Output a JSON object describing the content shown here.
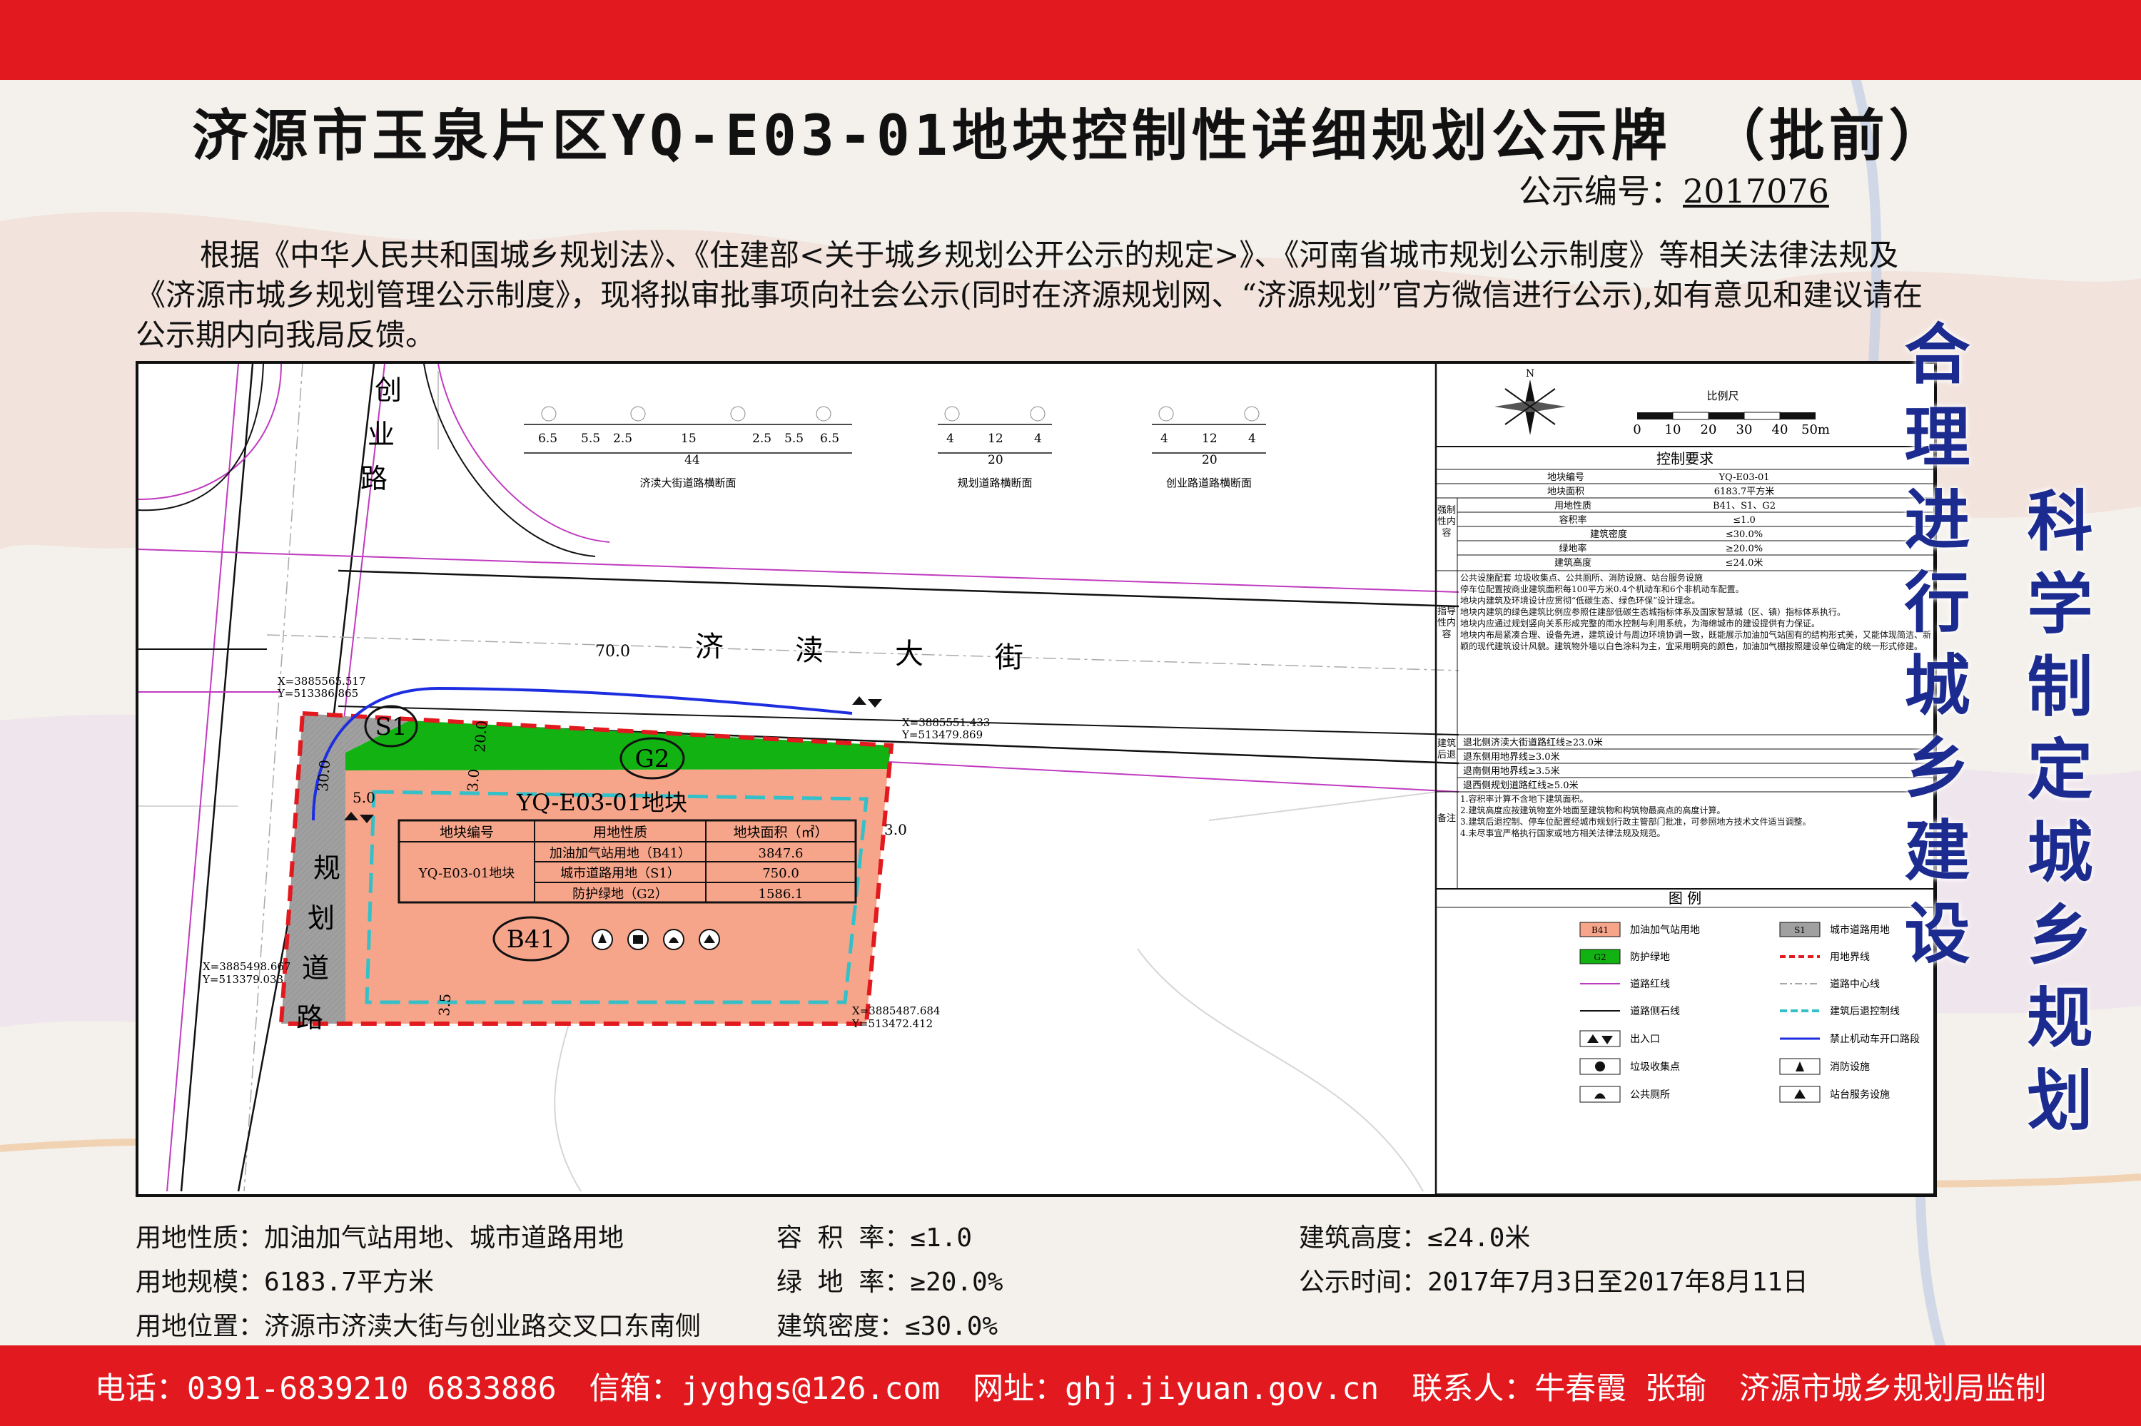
{
  "title": "济源市玉泉片区YQ-E03-01地块控制性详细规划公示牌 （批前）",
  "notice_label": "公示编号：",
  "notice_no": "2017076",
  "intro": "根据《中华人民共和国城乡规划法》、《住建部<关于城乡规划公开公示的规定>》、《河南省城市规划公示制度》等相关法律法规及《济源市城乡规划管理公示制度》，现将拟审批事项向社会公示(同时在济源规划网、“济源规划”官方微信进行公示),如有意见和建议请在公示期内向我局反馈。",
  "slogans": {
    "left": "合理进行城乡建设",
    "right": "科学制定城乡规划"
  },
  "map": {
    "roads": {
      "chuangye": "创业路",
      "jidu": "济渎大街",
      "guihua": "规划道路"
    },
    "road_width_jidu": "70.0",
    "dims": {
      "d30_left": "30.0",
      "d20": "20.0",
      "d3_top": "3.0",
      "d5": "5.0",
      "d3_right": "3.0",
      "d3_bottom": "3.5"
    },
    "parcel_labels": {
      "s1": "S1",
      "g2": "G2",
      "b41": "B41",
      "block": "YQ-E03-01地块"
    },
    "coords": [
      {
        "x": "X=3885565.517",
        "y": "Y=513386.865"
      },
      {
        "x": "X=3885551.433",
        "y": "Y=513479.869"
      },
      {
        "x": "X=3885498.667",
        "y": "Y=513379.033"
      },
      {
        "x": "X=3885487.684",
        "y": "Y=513472.412"
      }
    ],
    "parcel_table": {
      "headers": [
        "地块编号",
        "用地性质",
        "地块面积（㎡）"
      ],
      "block_id": "YQ-E03-01地块",
      "rows": [
        [
          "加油加气站用地（B41）",
          "3847.6"
        ],
        [
          "城市道路用地（S1）",
          "750.0"
        ],
        [
          "防护绿地（G2）",
          "1586.1"
        ]
      ]
    },
    "sections": [
      {
        "dims": [
          "6.5",
          "5.5",
          "2.5",
          "15",
          "2.5",
          "5.5",
          "6.5"
        ],
        "total": "44",
        "caption": "济渎大街道路横断面"
      },
      {
        "dims": [
          "4",
          "12",
          "4"
        ],
        "total": "20",
        "caption": "规划道路横断面"
      },
      {
        "dims": [
          "4",
          "12",
          "4"
        ],
        "total": "20",
        "caption": "创业路道路横断面"
      }
    ],
    "north": "N",
    "scale": {
      "label": "比例尺",
      "ticks": [
        "0",
        "10",
        "20",
        "30",
        "40",
        "50m"
      ]
    },
    "control": {
      "title": "控制要求",
      "rows": [
        [
          "地块编号",
          "YQ-E03-01"
        ],
        [
          "地块面积",
          "6183.7平方米"
        ]
      ],
      "mandatory_label": "强制性内容",
      "mandatory": [
        [
          "用地性质",
          "B41、S1、G2"
        ],
        [
          "容积率",
          "≤1.0"
        ],
        [
          "建筑密度",
          "≤30.0%"
        ],
        [
          "绿地率",
          "≥20.0%"
        ],
        [
          "建筑高度",
          "≤24.0米"
        ]
      ],
      "guide_label": "指导性内容",
      "guide": [
        "公共设施配套 垃圾收集点、公共厕所、消防设施、站台服务设施",
        "停车位配置按商业建筑面积每100平方米0.4个机动车和6个非机动车配置。",
        "地块内建筑及环境设计应贯彻“低碳生态、绿色环保”设计理念。",
        "地块内建筑的绿色建筑比例应参照住建部低碳生态城指标体系及国家智慧城（区、镇）指标体系执行。",
        "地块内应通过规划竖向关系形成完整的雨水控制与利用系统，为海绵城市的建设提供有力保证。",
        "地块内布局紧凑合理、设备先进，建筑设计与周边环境协调一致，既能展示加油加气站固有的结构形式美，又能体现简洁、新颖的现代建筑设计风貌。建筑物外墙以白色涂料为主，宜采用明亮的颜色，加油加气棚按照建设单位确定的统一形式修建。"
      ],
      "setback_label": "建筑后退",
      "setback": [
        "退北侧济渎大街道路红线≥23.0米",
        "退东侧用地界线≥3.0米",
        "退南侧用地界线≥3.5米",
        "退西侧规划道路红线≥5.0米"
      ],
      "notes_label": "备注",
      "notes": [
        "1.容积率计算不含地下建筑面积。",
        "2.建筑高度应按建筑物室外地面至建筑物和构筑物最高点的高度计算。",
        "3.建筑后退控制、停车位配置经城市规划行政主管部门批准，可参照地方技术文件适当调整。",
        "4.未尽事宜严格执行国家或地方相关法律法规及规范。"
      ]
    },
    "legend": {
      "title": "图 例",
      "items": [
        {
          "code": "B41",
          "label": "加油加气站用地"
        },
        {
          "code": "S1",
          "label": "城市道路用地"
        },
        {
          "code": "G2",
          "label": "防护绿地"
        },
        {
          "code": "",
          "label": "用地界线"
        },
        {
          "code": "",
          "label": "道路红线"
        },
        {
          "code": "",
          "label": "道路中心线"
        },
        {
          "code": "",
          "label": "道路侧石线"
        },
        {
          "code": "",
          "label": "建筑后退控制线"
        },
        {
          "code": "",
          "label": "出入口"
        },
        {
          "code": "",
          "label": "禁止机动车开口路段"
        },
        {
          "code": "",
          "label": "垃圾收集点"
        },
        {
          "code": "",
          "label": "消防设施"
        },
        {
          "code": "",
          "label": "公共厕所"
        },
        {
          "code": "",
          "label": "站台服务设施"
        }
      ]
    }
  },
  "info": {
    "land_use": "用地性质：加油加气站用地、城市道路用地",
    "land_scale": "用地规模：6183.7平方米",
    "location": "用地位置：济源市济渎大街与创业路交叉口东南侧",
    "far": "容 积 率：≤1.0",
    "green": "绿 地 率：≥20.0%",
    "density": "建筑密度：≤30.0%",
    "height": "建筑高度：≤24.0米",
    "period": "公示时间：2017年7月3日至2017年8月11日"
  },
  "footer": {
    "phone": "电话：0391-6839210 6833886",
    "email": "信箱：jyghgs@126.com",
    "web": "网址：ghj.jiyuan.gov.cn",
    "contact": "联系人：牛春霞 张瑜",
    "supervisor": "济源市城乡规划局监制"
  },
  "colors": {
    "band": "#e21a1f",
    "b41": "#f7a58a",
    "g2": "#12b213",
    "s1": "#a0a0a0",
    "slogan": "#1c2b8f",
    "redline": "#c03ac0",
    "setback": "#34c0c8"
  }
}
